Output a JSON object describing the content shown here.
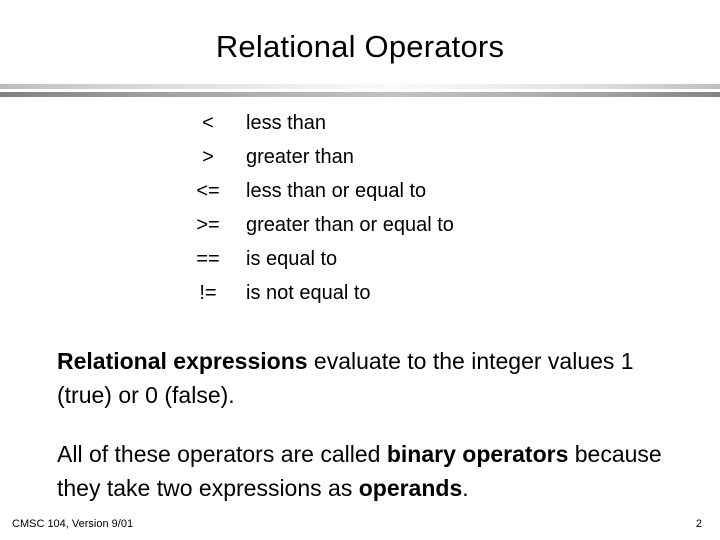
{
  "slide": {
    "title": "Relational Operators",
    "operators": [
      {
        "symbol": "<",
        "meaning": "less than"
      },
      {
        "symbol": ">",
        "meaning": "greater than"
      },
      {
        "symbol": "<=",
        "meaning": "less than or equal to"
      },
      {
        "symbol": ">=",
        "meaning": "greater than or equal to"
      },
      {
        "symbol": "==",
        "meaning": "is equal to"
      },
      {
        "symbol": "!=",
        "meaning": "is not equal to"
      }
    ],
    "paragraph_1": {
      "bold_lead": "Relational expressions",
      "rest": " evaluate to the integer values 1 (true) or 0 (false)."
    },
    "paragraph_2": {
      "part_1": "All of these operators are called ",
      "bold_1": "binary operators",
      "part_2": " because they take two expressions as ",
      "bold_2": "operands",
      "part_3": "."
    },
    "footer": {
      "course": "CMSC 104, Version 9/01",
      "page_number": "2"
    }
  }
}
